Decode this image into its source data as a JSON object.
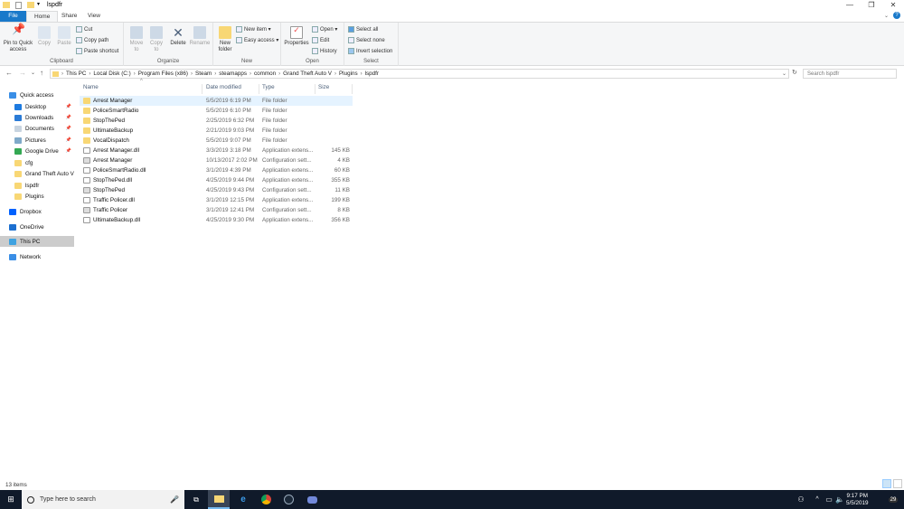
{
  "window": {
    "title": "lspdfr",
    "minimize": "—",
    "maximize": "❐",
    "close": "✕"
  },
  "ribbon_tabs": [
    "File",
    "Home",
    "Share",
    "View"
  ],
  "ribbon": {
    "clipboard": {
      "label": "Clipboard",
      "pin": "Pin to Quick access",
      "copy": "Copy",
      "paste": "Paste",
      "cut": "Cut",
      "copy_path": "Copy path",
      "paste_shortcut": "Paste shortcut"
    },
    "organize": {
      "label": "Organize",
      "move_to": "Move to",
      "copy_to": "Copy to",
      "delete": "Delete",
      "rename": "Rename"
    },
    "new": {
      "label": "New",
      "new_folder": "New folder",
      "new_item": "New item ▾",
      "easy_access": "Easy access ▾"
    },
    "open": {
      "label": "Open",
      "properties": "Properties",
      "open": "Open ▾",
      "edit": "Edit",
      "history": "History"
    },
    "select": {
      "label": "Select",
      "select_all": "Select all",
      "select_none": "Select none",
      "invert": "Invert selection"
    }
  },
  "address": {
    "crumbs": [
      "This PC",
      "Local Disk (C:)",
      "Program Files (x86)",
      "Steam",
      "steamapps",
      "common",
      "Grand Theft Auto V",
      "Plugins",
      "lspdfr"
    ],
    "search_placeholder": "Search lspdfr"
  },
  "sidebar": [
    {
      "label": "Quick access",
      "icon": "star-icon",
      "color": "#3a8ee6"
    },
    {
      "label": "Desktop",
      "icon": "desktop-icon",
      "color": "#1e7be0",
      "pinned": true
    },
    {
      "label": "Downloads",
      "icon": "download-icon",
      "color": "#2b7bd6",
      "pinned": true
    },
    {
      "label": "Documents",
      "icon": "document-icon",
      "color": "#c8d4e0",
      "pinned": true
    },
    {
      "label": "Pictures",
      "icon": "pictures-icon",
      "color": "#7fa9c9",
      "pinned": true
    },
    {
      "label": "Google Drive",
      "icon": "google-drive-icon",
      "color": "#34a853",
      "pinned": true
    },
    {
      "label": "cfg",
      "icon": "folder-icon",
      "color": "#f8d775"
    },
    {
      "label": "Grand Theft Auto V",
      "icon": "folder-icon",
      "color": "#f8d775"
    },
    {
      "label": "lspdfr",
      "icon": "folder-icon",
      "color": "#f8d775"
    },
    {
      "label": "Plugins",
      "icon": "folder-icon",
      "color": "#f8d775"
    },
    {
      "label": "Dropbox",
      "icon": "dropbox-icon",
      "color": "#0061fe"
    },
    {
      "label": "OneDrive",
      "icon": "onedrive-icon",
      "color": "#1c6fd0"
    },
    {
      "label": "This PC",
      "icon": "computer-icon",
      "color": "#3fa2e0",
      "selected": true
    },
    {
      "label": "Network",
      "icon": "network-icon",
      "color": "#3a8ee6"
    }
  ],
  "columns": [
    "Name",
    "Date modified",
    "Type",
    "Size"
  ],
  "files": [
    {
      "name": "Arrest Manager",
      "date": "5/5/2019 6:19 PM",
      "type": "File folder",
      "size": "",
      "kind": "folder"
    },
    {
      "name": "PoliceSmartRadio",
      "date": "5/5/2019 6:10 PM",
      "type": "File folder",
      "size": "",
      "kind": "folder"
    },
    {
      "name": "StopThePed",
      "date": "2/25/2019 6:32 PM",
      "type": "File folder",
      "size": "",
      "kind": "folder"
    },
    {
      "name": "UltimateBackup",
      "date": "2/21/2019 9:03 PM",
      "type": "File folder",
      "size": "",
      "kind": "folder"
    },
    {
      "name": "VocalDispatch",
      "date": "5/5/2019 9:07 PM",
      "type": "File folder",
      "size": "",
      "kind": "folder"
    },
    {
      "name": "Arrest Manager.dll",
      "date": "3/3/2019 3:18 PM",
      "type": "Application extens...",
      "size": "145 KB",
      "kind": "dll"
    },
    {
      "name": "Arrest Manager",
      "date": "10/13/2017 2:02 PM",
      "type": "Configuration sett...",
      "size": "4 KB",
      "kind": "cfg"
    },
    {
      "name": "PoliceSmartRadio.dll",
      "date": "3/1/2019 4:39 PM",
      "type": "Application extens...",
      "size": "60 KB",
      "kind": "dll"
    },
    {
      "name": "StopThePed.dll",
      "date": "4/25/2019 9:44 PM",
      "type": "Application extens...",
      "size": "355 KB",
      "kind": "dll"
    },
    {
      "name": "StopThePed",
      "date": "4/25/2019 9:43 PM",
      "type": "Configuration sett...",
      "size": "11 KB",
      "kind": "cfg"
    },
    {
      "name": "Traffic Policer.dll",
      "date": "3/1/2019 12:15 PM",
      "type": "Application extens...",
      "size": "199 KB",
      "kind": "dll"
    },
    {
      "name": "Traffic Policer",
      "date": "3/1/2019 12:41 PM",
      "type": "Configuration sett...",
      "size": "8 KB",
      "kind": "cfg"
    },
    {
      "name": "UltimateBackup.dll",
      "date": "4/25/2019 9:30 PM",
      "type": "Application extens...",
      "size": "356 KB",
      "kind": "dll"
    }
  ],
  "status": {
    "count": "13 items"
  },
  "taskbar": {
    "search_placeholder": "Type here to search",
    "time": "9:17 PM",
    "date": "5/5/2019",
    "notifications": "29"
  }
}
